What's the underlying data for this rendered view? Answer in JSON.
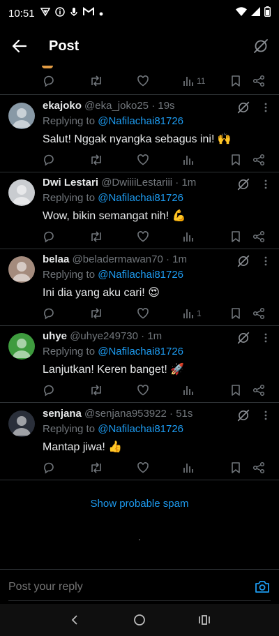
{
  "status": {
    "time": "10:51",
    "left_icons": [
      "vpn-icon",
      "info-icon",
      "mic-icon",
      "gmail-icon",
      "dot-icon"
    ],
    "right_icons": [
      "wifi-icon",
      "signal-icon",
      "battery-icon"
    ]
  },
  "header": {
    "title": "Post"
  },
  "partial": {
    "views": "11"
  },
  "tweets": [
    {
      "name": "ekajoko",
      "handle": "@eka_joko25",
      "time": "· 19s",
      "replying_prefix": "Replying to ",
      "mention": "@Nafilachai81726",
      "text": "Salut! Nggak nyangka sebagus ini! 🙌",
      "views": "",
      "avatar_color": "#8899a6"
    },
    {
      "name": "Dwi Lestari",
      "handle": "@DwiiiiLestariii",
      "time": "· 1m",
      "replying_prefix": "Replying to ",
      "mention": "@Nafilachai81726",
      "text": "Wow, bikin semangat nih! 💪",
      "views": "",
      "avatar_color": "#c9ccd0"
    },
    {
      "name": "belaa",
      "handle": "@beladermawan70",
      "time": "· 1m",
      "replying_prefix": "Replying to ",
      "mention": "@Nafilachai81726",
      "text": "Ini dia yang aku cari! 😍",
      "views": "1",
      "avatar_color": "#a48b7d"
    },
    {
      "name": "uhye",
      "handle": "@uhye249730",
      "time": "· 1m",
      "replying_prefix": "Replying to ",
      "mention": "@Nafilachai81726",
      "text": "Lanjutkan! Keren banget! 🚀",
      "views": "",
      "avatar_color": "#3e9b3e"
    },
    {
      "name": "senjana",
      "handle": "@senjana953922",
      "time": "· 51s",
      "replying_prefix": "Replying to ",
      "mention": "@Nafilachai81726",
      "text": "Mantap jiwa! 👍",
      "views": "",
      "avatar_color": "#2a2f3a"
    }
  ],
  "spam_link": "Show probable spam",
  "reply": {
    "placeholder": "Post your reply"
  },
  "colors": {
    "accent": "#1d9bf0",
    "muted": "#71767b",
    "divider": "#2f3336"
  }
}
